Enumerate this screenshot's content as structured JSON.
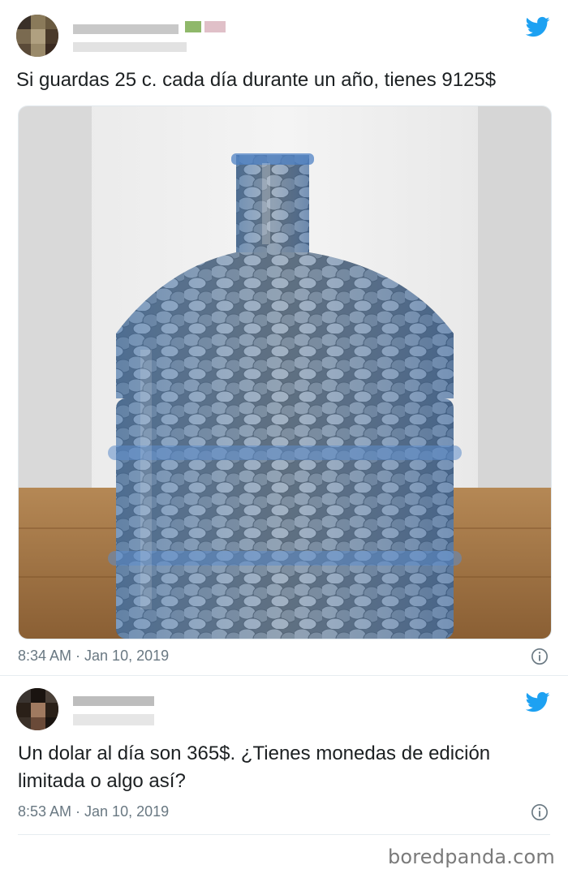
{
  "tweet1": {
    "text": "Si guardas 25 c. cada día durante un año, tienes 9125$",
    "meta": "8:34 AM · Jan 10, 2019",
    "icons": {
      "platform": "twitter-bird",
      "info": "info-circle"
    }
  },
  "tweet2": {
    "text": "Un dolar al día son 365$. ¿Tienes monedas de edición limitada o algo así?",
    "meta": "8:53 AM · Jan 10, 2019",
    "icons": {
      "platform": "twitter-bird",
      "info": "info-circle"
    }
  },
  "watermark": "boredpanda.com",
  "colors": {
    "twitter_blue": "#1da1f2",
    "meta_gray": "#697882",
    "text": "#1c2022"
  }
}
